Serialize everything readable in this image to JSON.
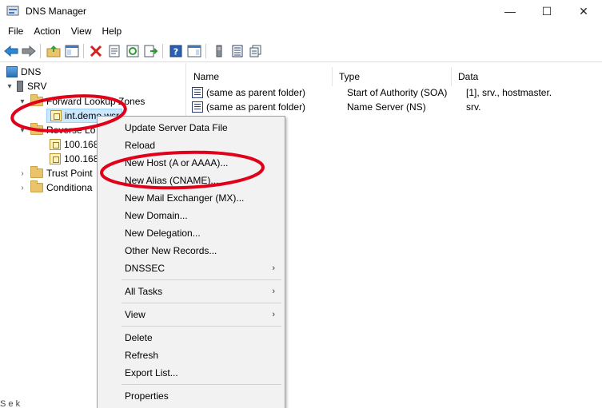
{
  "window": {
    "title": "DNS Manager",
    "minimize_glyph": "—",
    "maximize_glyph": "☐",
    "close_glyph": "✕"
  },
  "menubar": {
    "items": [
      "File",
      "Action",
      "View",
      "Help"
    ]
  },
  "tree": {
    "root": "DNS",
    "server": "SRV",
    "forward_zones": "Forward Lookup Zones",
    "zone_selected": "int.demo.wsr",
    "reverse_zones": "Reverse Lo",
    "reverse_child_1": "100.168",
    "reverse_child_2": "100.168",
    "trust_points": "Trust Point",
    "conditional": "Conditiona"
  },
  "records": {
    "columns": [
      "Name",
      "Type",
      "Data"
    ],
    "rows": [
      {
        "name": "(same as parent folder)",
        "type": "Start of Authority (SOA)",
        "data": "[1], srv., hostmaster."
      },
      {
        "name": "(same as parent folder)",
        "type": "Name Server (NS)",
        "data": "srv."
      }
    ]
  },
  "context_menu": {
    "update": "Update Server Data File",
    "reload": "Reload",
    "new_host": "New Host (A or AAAA)...",
    "new_alias": "New Alias (CNAME)...",
    "new_mx": "New Mail Exchanger (MX)...",
    "new_domain": "New Domain...",
    "new_delegation": "New Delegation...",
    "other_records": "Other New Records...",
    "dnssec": "DNSSEC",
    "all_tasks": "All Tasks",
    "view": "View",
    "delete": "Delete",
    "refresh": "Refresh",
    "export": "Export List...",
    "properties": "Properties",
    "submenu_arrow": "›"
  },
  "status": {
    "text": "S e                          k"
  },
  "colors": {
    "annotation": "#e0001a",
    "selection": "#cce8ff",
    "menu_bg": "#f2f2f2"
  }
}
